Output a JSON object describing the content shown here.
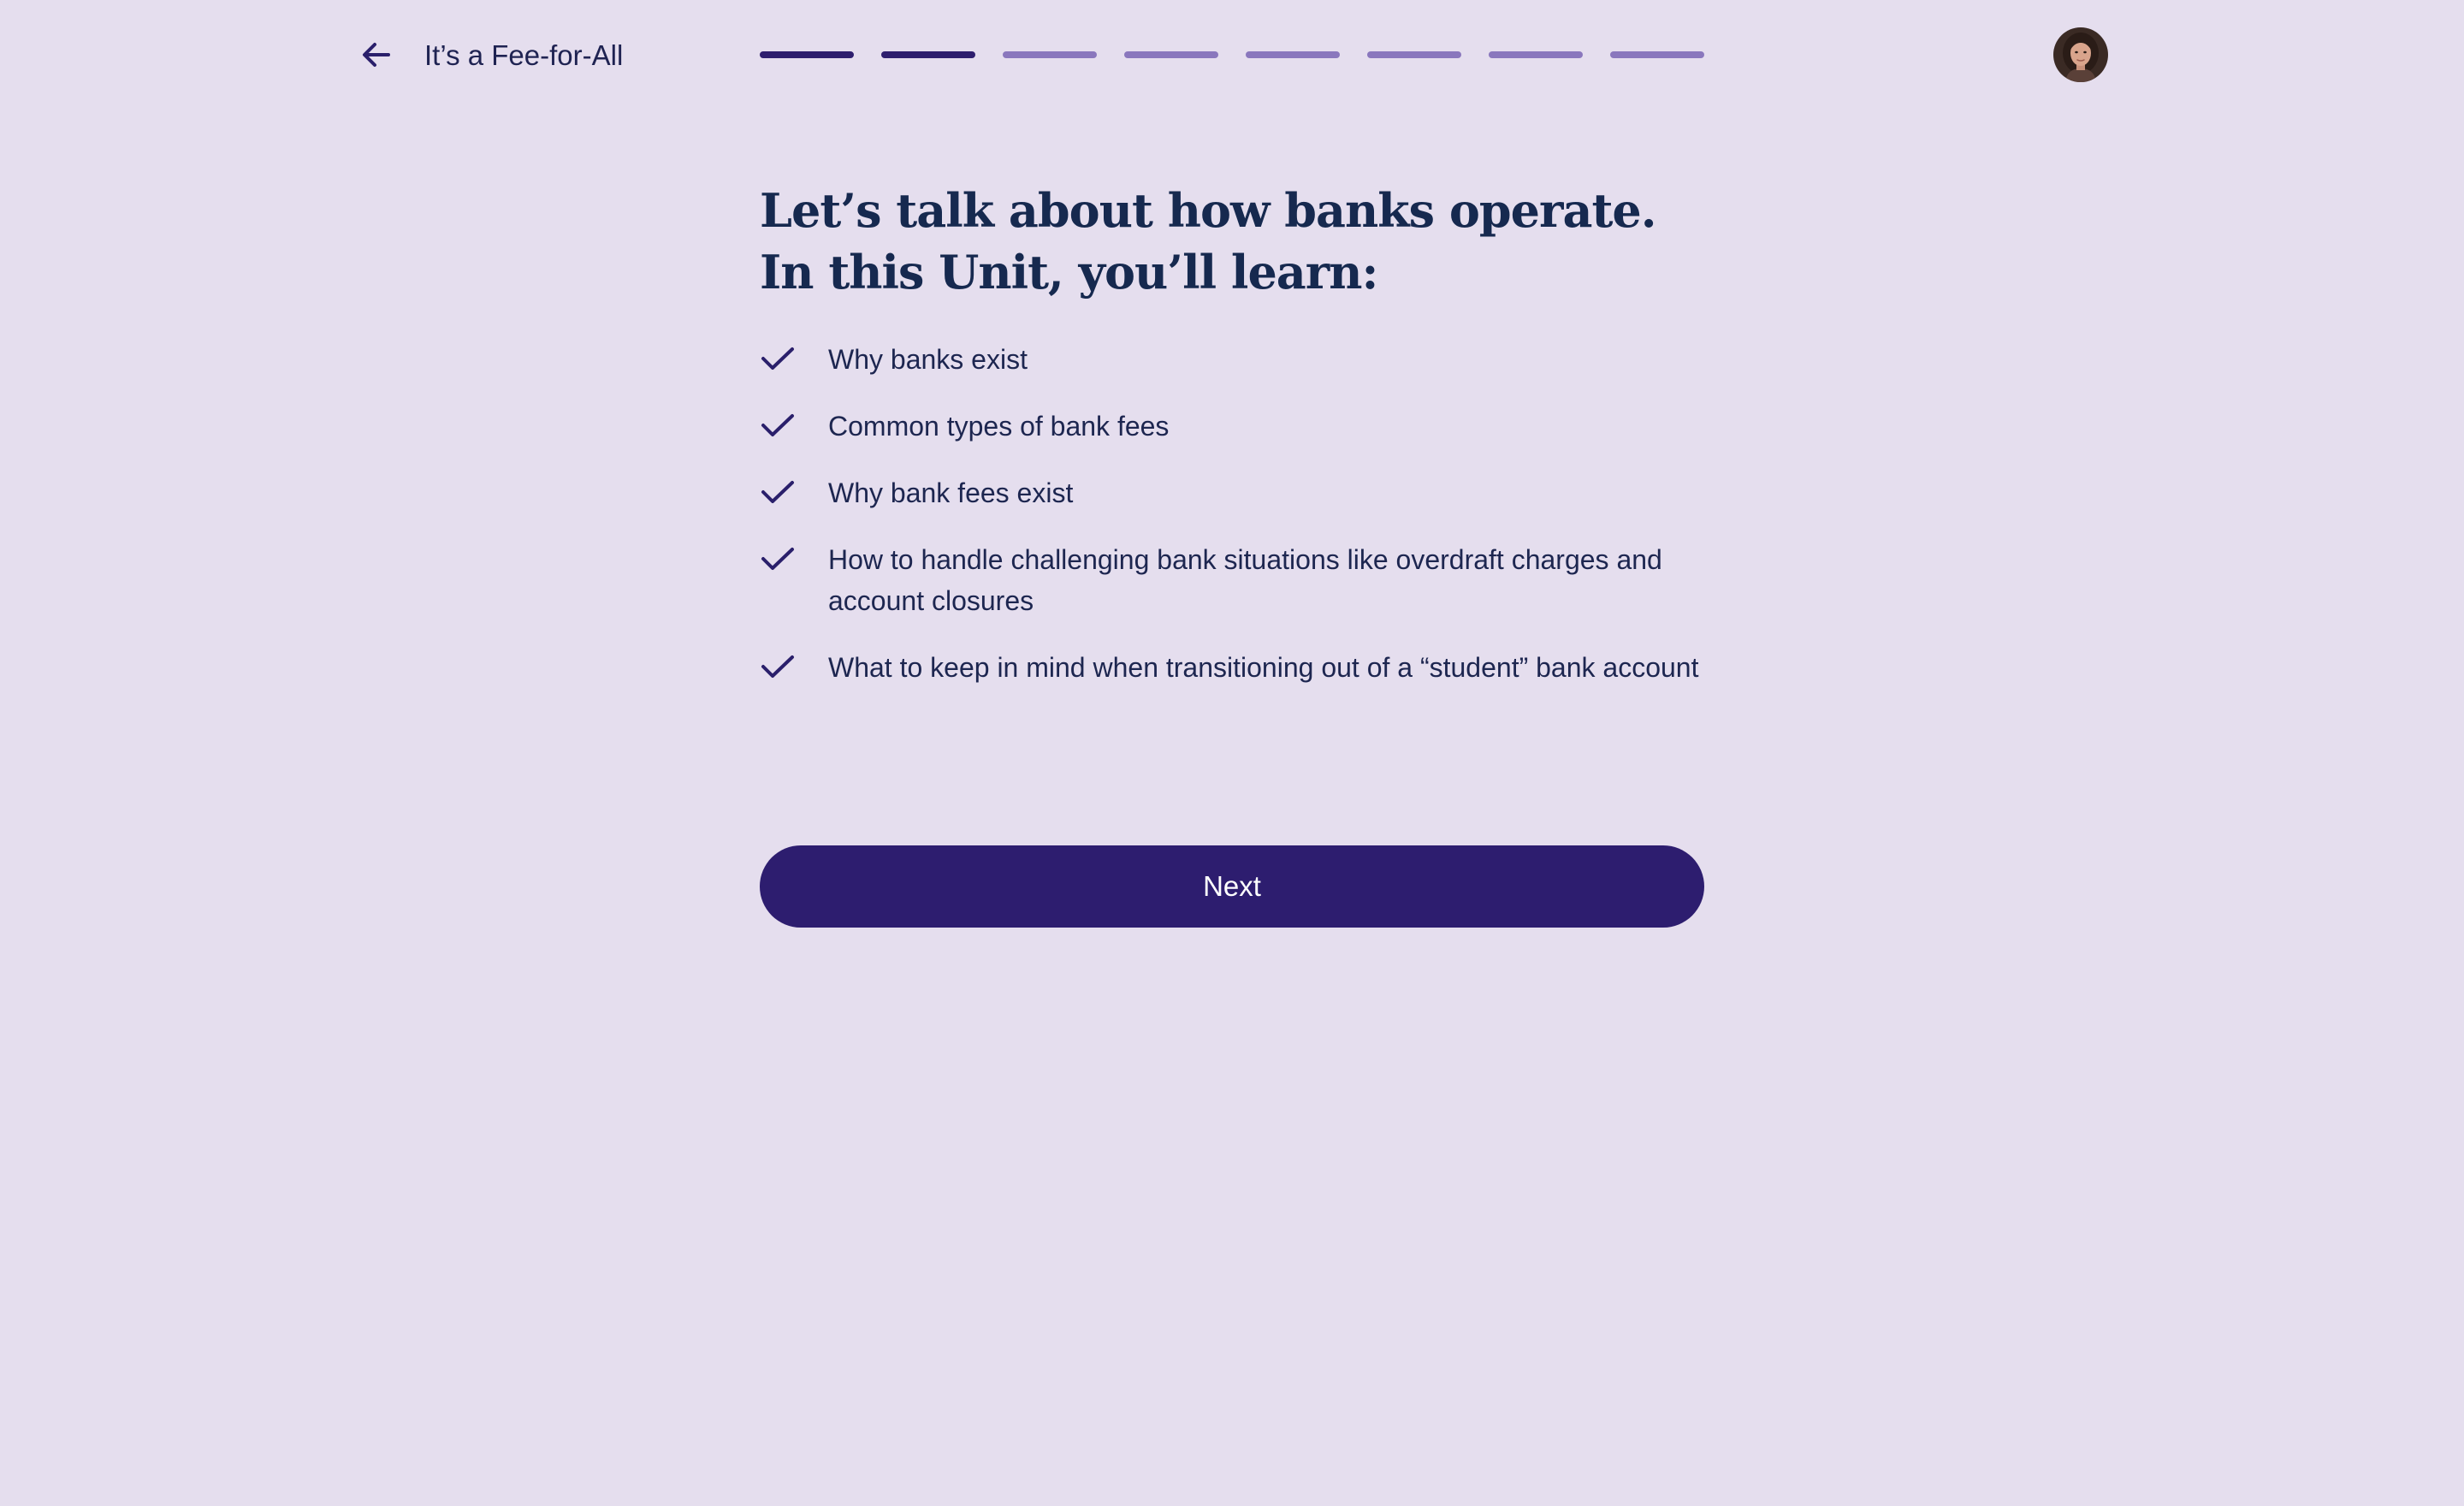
{
  "header": {
    "back_icon": "arrow-left-icon",
    "title": "It’s a Fee-for-All",
    "progress": {
      "total_steps": 8,
      "completed_steps": 2
    },
    "avatar_icon": "user-avatar"
  },
  "main": {
    "heading": "Let’s talk about how banks operate. In this Unit, you’ll learn:",
    "check_icon": "checkmark-icon",
    "objectives": [
      "Why banks exist",
      "Common types of bank fees",
      "Why bank fees exist",
      "How to handle challenging bank situations like overdraft charges and account closures",
      "What to keep in mind when transitioning out of a “student” bank account"
    ],
    "next_label": "Next"
  },
  "colors": {
    "background": "#e5deee",
    "accent": "#2d1d6f",
    "progress_done": "#2e1e6e",
    "progress_todo": "#8a77bd",
    "text": "#16294f"
  }
}
